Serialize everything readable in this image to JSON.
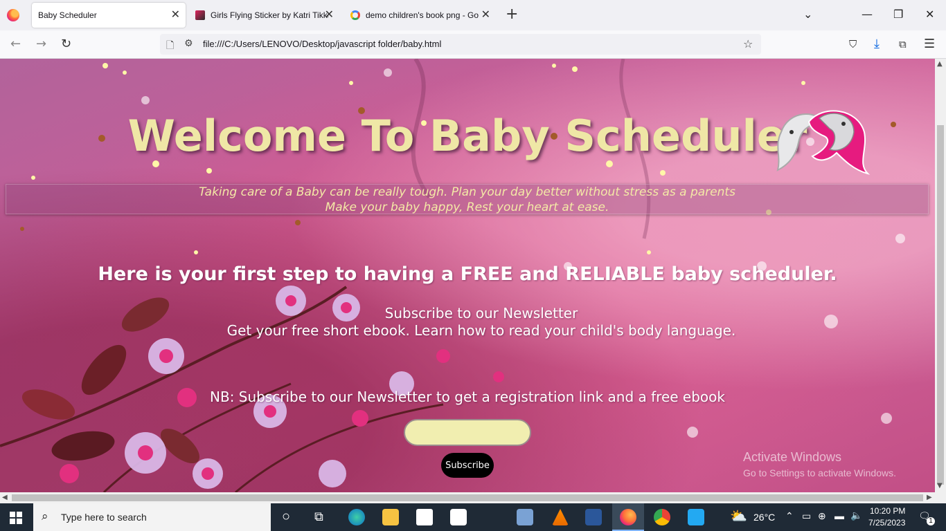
{
  "browser": {
    "tabs": [
      {
        "title": "Baby Scheduler",
        "active": true
      },
      {
        "title": "Girls Flying Sticker by Katri Tikka",
        "active": false
      },
      {
        "title": "demo children's book png - Go",
        "active": false
      }
    ],
    "url": "file:///C:/Users/LENOVO/Desktop/javascript folder/baby.html"
  },
  "page": {
    "title": "Welcome To Baby Scheduler",
    "tagline_line1": "Taking care of a Baby can be really tough. Plan your day better without stress as a parents",
    "tagline_line2": "Make your baby happy, Rest your heart at ease.",
    "headline": "Here is your first step to having a FREE and RELIABLE baby scheduler.",
    "newsletter_title": "Subscribe to our Newsletter",
    "newsletter_text": "Get your free short ebook. Learn how to read your child's body language.",
    "nb": "NB: Subscribe to our Newsletter to get a registration link and a free ebook",
    "email_value": "",
    "subscribe_label": "Subscribe"
  },
  "watermark": {
    "line1": "Activate Windows",
    "line2": "Go to Settings to activate Windows."
  },
  "taskbar": {
    "search_placeholder": "Type here to search",
    "weather": "26°C",
    "time": "10:20 PM",
    "date": "7/25/2023",
    "notification_count": "1"
  },
  "colors": {
    "title": "#efe7a6",
    "accent_pink": "#c95e97",
    "input_bg": "#f1eeb0"
  }
}
